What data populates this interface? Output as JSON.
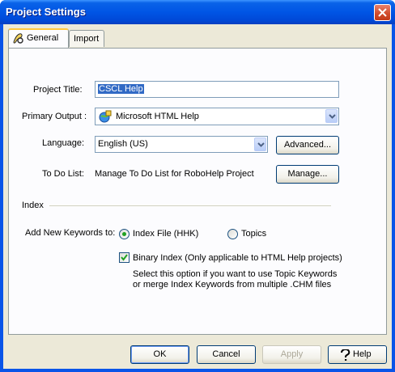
{
  "window": {
    "title": "Project Settings"
  },
  "tabs": [
    {
      "label": "General",
      "active": true
    },
    {
      "label": "Import",
      "active": false
    }
  ],
  "general": {
    "project_title": {
      "label": "Project Title:",
      "value": "CSCL Help"
    },
    "primary_output": {
      "label": "Primary Output :",
      "value": "Microsoft HTML Help"
    },
    "language": {
      "label": "Language:",
      "value": "English (US)",
      "advanced_button": "Advanced..."
    },
    "todo": {
      "label": "To Do List:",
      "text": "Manage To Do List for RoboHelp Project",
      "manage_button": "Manage..."
    },
    "index": {
      "section_label": "Index",
      "keywords_label": "Add New Keywords to:",
      "options": [
        {
          "label": "Index File (HHK)",
          "selected": true
        },
        {
          "label": "Topics",
          "selected": false
        }
      ],
      "binary_index": {
        "label": "Binary Index (Only applicable to HTML Help projects)",
        "checked": true
      },
      "note_line1": "Select this option if you want to use Topic Keywords",
      "note_line2": "or merge Index Keywords  from multiple .CHM files"
    }
  },
  "footer": {
    "ok": "OK",
    "cancel": "Cancel",
    "apply": "Apply",
    "help": "Help"
  },
  "colors": {
    "title_bar": "#0055e5",
    "dialog_bg": "#ece9d8",
    "selection": "#316ac5",
    "tab_highlight": "#ffc73c"
  }
}
